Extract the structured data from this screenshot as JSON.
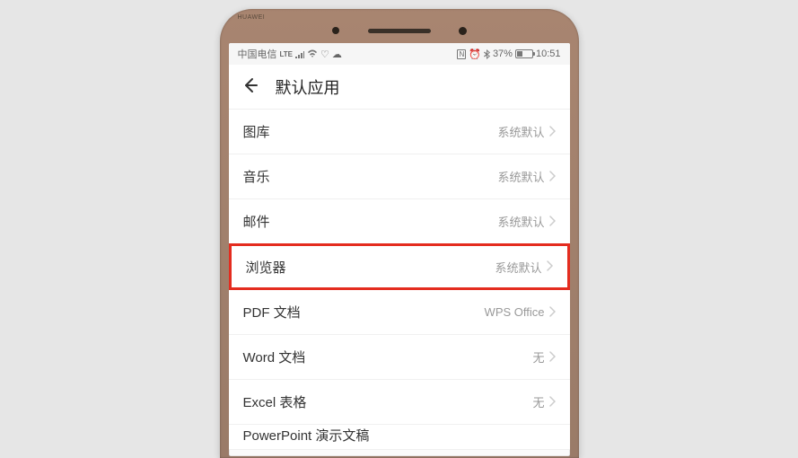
{
  "statusBar": {
    "carrier": "中国电信",
    "lte": "LTE",
    "batteryPercent": "37%",
    "time": "10:51"
  },
  "header": {
    "title": "默认应用"
  },
  "items": [
    {
      "label": "图库",
      "value": "系统默认",
      "highlighted": false
    },
    {
      "label": "音乐",
      "value": "系统默认",
      "highlighted": false
    },
    {
      "label": "邮件",
      "value": "系统默认",
      "highlighted": false
    },
    {
      "label": "浏览器",
      "value": "系统默认",
      "highlighted": true
    },
    {
      "label": "PDF 文档",
      "value": "WPS Office",
      "highlighted": false
    },
    {
      "label": "Word 文档",
      "value": "无",
      "highlighted": false
    },
    {
      "label": "Excel 表格",
      "value": "无",
      "highlighted": false
    },
    {
      "label": "PowerPoint 演示文稿",
      "value": "",
      "highlighted": false
    }
  ]
}
